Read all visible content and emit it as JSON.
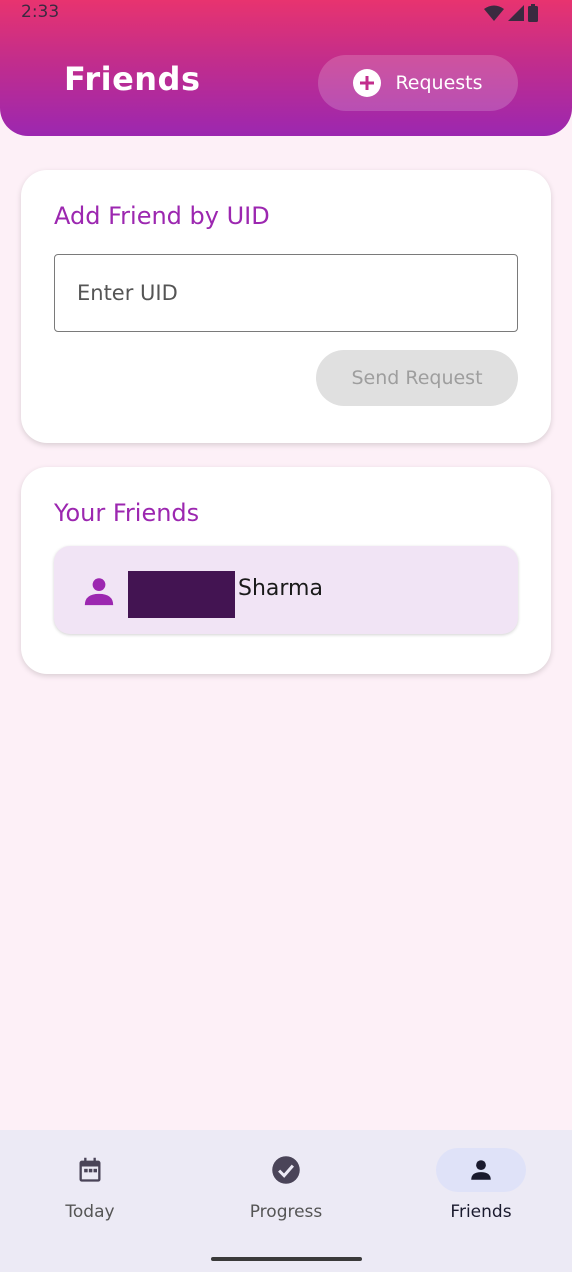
{
  "status_bar": {
    "time": "2:33"
  },
  "header": {
    "title": "Friends",
    "requests_label": "Requests"
  },
  "add_friend": {
    "title": "Add Friend by UID",
    "uid_placeholder": "Enter UID",
    "uid_value": "",
    "send_label": "Send Request"
  },
  "friends": {
    "title": "Your Friends",
    "items": [
      {
        "name": "Sharma"
      }
    ]
  },
  "nav": {
    "items": [
      {
        "label": "Today",
        "icon": "calendar-icon"
      },
      {
        "label": "Progress",
        "icon": "check-circle-icon"
      },
      {
        "label": "Friends",
        "icon": "person-icon",
        "active": true
      }
    ]
  },
  "colors": {
    "accent": "#9c27b0",
    "header_top": "#e8336f",
    "background": "#fdf0f7",
    "friend_item_bg": "#f1e4f5"
  }
}
